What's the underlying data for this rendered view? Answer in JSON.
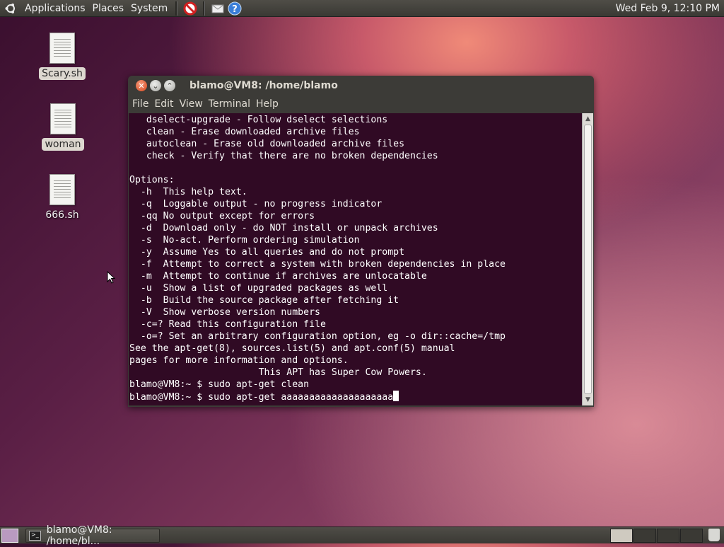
{
  "top_panel": {
    "menus": [
      "Applications",
      "Places",
      "System"
    ],
    "launchers": [
      "no-entry-icon",
      "mail-icon",
      "help-icon"
    ],
    "clock": "Wed Feb  9, 12:10 PM"
  },
  "desktop_icons": [
    {
      "label": "Scary.sh"
    },
    {
      "label": "woman"
    },
    {
      "label": "666.sh"
    }
  ],
  "terminal": {
    "title": "blamo@VM8: /home/blamo",
    "menu": [
      "File",
      "Edit",
      "View",
      "Terminal",
      "Help"
    ],
    "lines": [
      "   dselect-upgrade - Follow dselect selections",
      "   clean - Erase downloaded archive files",
      "   autoclean - Erase old downloaded archive files",
      "   check - Verify that there are no broken dependencies",
      "",
      "Options:",
      "  -h  This help text.",
      "  -q  Loggable output - no progress indicator",
      "  -qq No output except for errors",
      "  -d  Download only - do NOT install or unpack archives",
      "  -s  No-act. Perform ordering simulation",
      "  -y  Assume Yes to all queries and do not prompt",
      "  -f  Attempt to correct a system with broken dependencies in place",
      "  -m  Attempt to continue if archives are unlocatable",
      "  -u  Show a list of upgraded packages as well",
      "  -b  Build the source package after fetching it",
      "  -V  Show verbose version numbers",
      "  -c=? Read this configuration file",
      "  -o=? Set an arbitrary configuration option, eg -o dir::cache=/tmp",
      "See the apt-get(8), sources.list(5) and apt.conf(5) manual",
      "pages for more information and options.",
      "                       This APT has Super Cow Powers.",
      "blamo@VM8:~ $ sudo apt-get clean"
    ],
    "prompt_line": "blamo@VM8:~ $ sudo apt-get aaaaaaaaaaaaaaaaaaaa"
  },
  "bottom_panel": {
    "task_label": "blamo@VM8: /home/bl..."
  }
}
